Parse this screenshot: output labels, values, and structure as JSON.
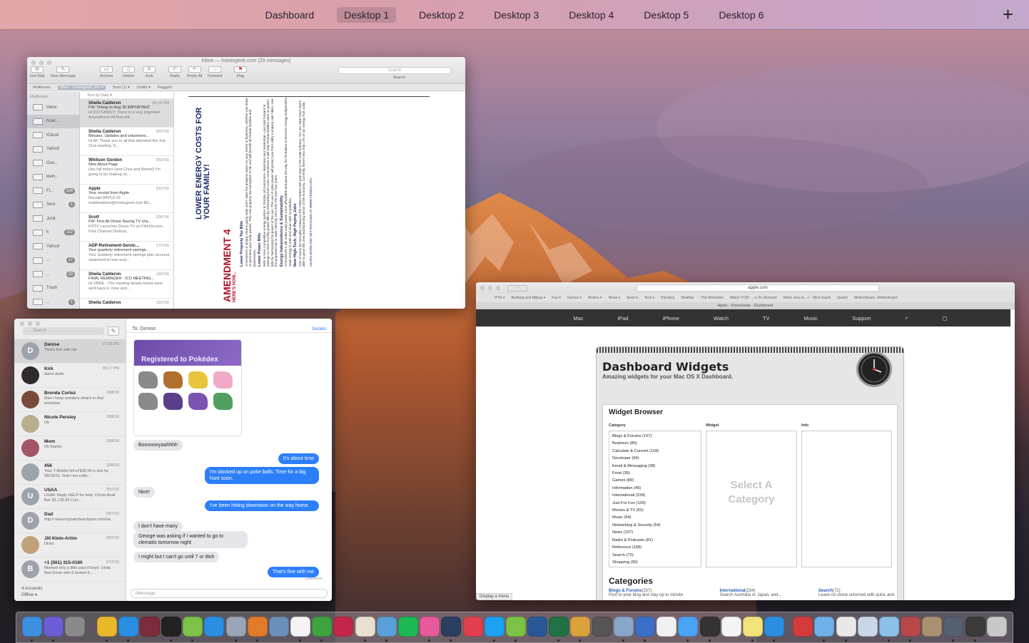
{
  "spaces": {
    "tabs": [
      "Dashboard",
      "Desktop 1",
      "Desktop 2",
      "Desktop 3",
      "Desktop 4",
      "Desktop 5",
      "Desktop 6"
    ],
    "active": "Desktop 1",
    "add_label": "+"
  },
  "mail": {
    "title": "Inbox — howtogeek.com (29 messages)",
    "toolbar": [
      "Get Mail",
      "New Message",
      "Archive",
      "Delete",
      "Junk",
      "Reply",
      "Reply All",
      "Forward",
      "Flag"
    ],
    "search_placeholder": "Search",
    "search_label": "Search",
    "favorites": [
      "Mailboxes",
      "Inbox - howtogeek.com ▾",
      "Sent (1) ▾",
      "Drafts ▾",
      "Flagged"
    ],
    "mailboxes_heading": "Mailboxes",
    "sort_label": "Sort by Date ▾",
    "mailboxes": [
      {
        "name": "Inbox",
        "count": ""
      },
      {
        "name": "howt...",
        "count": ""
      },
      {
        "name": "iCloud",
        "count": ""
      },
      {
        "name": "Yahoo!",
        "count": ""
      },
      {
        "name": "Goo...",
        "count": ""
      },
      {
        "name": "klein...",
        "count": ""
      },
      {
        "name": "Fl...",
        "count": "529"
      },
      {
        "name": "Sent",
        "count": "1"
      },
      {
        "name": "Junk",
        "count": ""
      },
      {
        "name": "h",
        "count": "112"
      },
      {
        "name": "Yahoo!",
        "count": ""
      },
      {
        "name": "...",
        "count": "17"
      },
      {
        "name": "...",
        "count": "20"
      },
      {
        "name": "Trash",
        "count": ""
      },
      {
        "name": "...",
        "count": "1"
      }
    ],
    "messages": [
      {
        "from": "Sheila Calderon",
        "date": "04:10 PM",
        "subject": "FW: Voting on Aug 30 IMPORTANT",
        "preview": "Hi ICO FAMILY: There is a very important Amendment #4 that will..."
      },
      {
        "from": "Sheila Calderon",
        "date": "26/7/16",
        "subject": "Minutes, Updates and volunteers...",
        "preview": "Hi All: Thank you to all that attended the July 21st meeting. It..."
      },
      {
        "from": "Whitson Gordon",
        "date": "26/7/16",
        "subject": "New About Page",
        "preview": "Hey full timers (and Chris and Akemi)! I'm going to be making so..."
      },
      {
        "from": "Apple",
        "date": "21/7/16",
        "subject": "Your receipt from Apple.",
        "preview": "Receipt APPLE ID matthewklein@howtogeek.com Bil..."
      },
      {
        "from": "Scott",
        "date": "20/7/16",
        "subject": "FW: First All Drone Racing TV cha...",
        "preview": "FOTV Launches Drone TV on FilmOn.com, First Channel Dedicat..."
      },
      {
        "from": "ADP-Retirement-Servic...",
        "date": "17/7/16",
        "subject": "Your quarterly retirement savings...",
        "preview": "Your quarterly retirement savings plan account statement is now avai..."
      },
      {
        "from": "Sheila Calderon",
        "date": "13/7/16",
        "subject": "FINAL REMINDER - ICO MEETING...",
        "preview": "Hi YAWE - The meeting details below were sent back in June and..."
      },
      {
        "from": "Sheila Calderon",
        "date": "13/7/16",
        "subject": "",
        "preview": ""
      }
    ],
    "flyer": {
      "amendment": "AMENDMENT 4",
      "tagline": "HERE'S HOW...",
      "headline": "LOWER ENERGY COSTS FOR YOUR FAMILY!",
      "sections": [
        {
          "head": "Lower Property Tax Bills",
          "body": "Amendment 4 simply means going solar won't raise the property taxes on your home or business, whether you lease or purchase your solar panels. This new property tax exemption is fair and will benefit all Florida families and businesses."
        },
        {
          "head": "Lower Power Bills",
          "body": "With a more competitive energy system in Florida, all customers—business and residential—can look forward to savings on their monthly power bills by eliminating fuel costs. Amendment 4 will help Florida families save on power bills by harnessing the power of the sun. The use of solar power will protect you from utility company rate hikes. Use the proposed tax to raise rates by 24% over the next four years."
        },
        {
          "head": "Energy Independence & Sustainability",
          "body": "Amendment 4 will make solar power more affordable and pave the way for Floridians to become energy independent. Solar energy is safe and clean with no pollution."
        },
        {
          "head": "New High-Tech, High Paying Jobs",
          "body": "One of every 83 new jobs created in the United States last year was in the solar industry. Yet, our state hasn't been able to grow this new and booming sector of the economy. Currently there's less than 1% of our energy from solar."
        }
      ],
      "footer": "LEARN MORE AND GET INVOLVED AT WWW.YES0N4.ORG"
    }
  },
  "messages_app": {
    "search_placeholder": "Search",
    "to_label": "To:",
    "to_name": "Denise",
    "details_label": "Details",
    "conversations": [
      {
        "name": "Denise",
        "time": "07:39 PM",
        "snippet": "That's fine with me",
        "initial": "D",
        "color": "#9ea3aa"
      },
      {
        "name": "Kirk",
        "time": "08:17 PM",
        "snippet": "damn dude",
        "initial": "",
        "color": "#2f2b2b"
      },
      {
        "name": "Brenda Cortez",
        "time": "18/8/16",
        "snippet": "Man I keep wonders what's in that envelope",
        "initial": "",
        "color": "#7a4b3a"
      },
      {
        "name": "Nicole Persley",
        "time": "18/8/16",
        "snippet": "Ok",
        "initial": "",
        "color": "#b8ae8e"
      },
      {
        "name": "Mom",
        "time": "18/8/16",
        "snippet": "Ok thanks",
        "initial": "",
        "color": "#a3556a"
      },
      {
        "name": "456",
        "time": "18/8/16",
        "snippet": "Your T-Mobile bill of $96.59 is due by 08/15/16. Visit t-mo.co/bi...",
        "initial": "",
        "color": "#9ea3aa"
      },
      {
        "name": "USAA",
        "time": "30/7/16",
        "snippet": "USAA: Reply HELP for help. Chckn Avail Bal: $1,139.93 Curr...",
        "initial": "U",
        "color": "#9ea3aa"
      },
      {
        "name": "Dad",
        "time": "29/7/16",
        "snippet": "http:// www.mypalmbeachpost.com/ne...",
        "initial": "D",
        "color": "#9ea3aa"
      },
      {
        "name": "Jill Klein-Artim",
        "time": "28/7/16",
        "snippet": "Dicks",
        "initial": "",
        "color": "#c0a27a"
      },
      {
        "name": "+1 (561) 315-0180",
        "time": "27/7/16",
        "snippet": "Worked only a little past 8 boyd. Linda flew Down with 6 broken b...",
        "initial": "B",
        "color": "#9ea3aa"
      }
    ],
    "accounts_label": "4 Accounts",
    "status_label": "Offline ▾",
    "poke_title": "Registered to Pokédex",
    "bubbles": [
      {
        "dir": "in",
        "text": "Booooooyaahhhh"
      },
      {
        "dir": "out",
        "text": "It's about time"
      },
      {
        "dir": "out",
        "text": "I'm stocked up on poke balls. Time for a big hunt soon."
      },
      {
        "dir": "in",
        "text": "Nice!"
      },
      {
        "dir": "out",
        "text": "I've been hitting downtown on the way home."
      },
      {
        "dir": "in",
        "text": "I don't have many"
      },
      {
        "dir": "in",
        "text": "George was asking if I wanted to go to clematis tomorrow night"
      },
      {
        "dir": "in",
        "text": "I might but I can't go until 7 or 8ish"
      },
      {
        "dir": "out",
        "text": "That's fine with me"
      }
    ],
    "delivered_label": "Delivered",
    "input_placeholder": "iMessage"
  },
  "safari": {
    "url": "apple.com",
    "favorites": [
      "HTG ▾",
      "Banking and Billpay ▾",
      "Fun ▾",
      "Games ▾",
      "Movies ▾",
      "News ▾",
      "Sport ▾",
      "Tech ▾",
      "Pandora",
      "Weather",
      "The Weinstein",
      "Watch TCM - ...s On Demand",
      "Metro new sc...> - Slick Depot",
      "Quartz",
      "Motherboard...Motherboard"
    ],
    "tab_title": "Apple - Downloads - Dashboard",
    "nav": [
      "Mac",
      "iPad",
      "iPhone",
      "Watch",
      "TV",
      "Music",
      "Support"
    ],
    "page_title": "Dashboard Widgets",
    "page_subtitle": "Amazing widgets for your Mac OS X Dashboard.",
    "browser_title": "Widget Browser",
    "col_category": "Category",
    "col_widget": "Widget",
    "col_info": "Info",
    "categories": [
      "Blogs & Forums (157)",
      "Business (85)",
      "Calculate & Convert (118)",
      "Developer (64)",
      "Email & Messaging (38)",
      "Food (35)",
      "Games (89)",
      "Information (49)",
      "International (234)",
      "Just For Fun (109)",
      "Movies & TV (62)",
      "Music (64)",
      "Networking & Security (54)",
      "News (107)",
      "Radio & Podcasts (81)",
      "Reference (168)",
      "Search (72)",
      "Shopping (90)"
    ],
    "select_prompt": "Select A Category",
    "categories_heading": "Categories",
    "category_links": [
      {
        "name": "Blogs & Forums",
        "count": "(157)",
        "desc": "Post to your blog and stay up to minute"
      },
      {
        "name": "International",
        "count": "(234)",
        "desc": "Search Australia or Japan, and..."
      },
      {
        "name": "Search",
        "count": "(72)",
        "desc": "Leave no stone unturned with quick and"
      }
    ],
    "status_text": "Display a menu"
  },
  "dock": {
    "apps": [
      {
        "name": "finder",
        "color": "#3d8fe0"
      },
      {
        "name": "siri",
        "color": "#6b5dd3"
      },
      {
        "name": "system-preferences",
        "color": "#8a8a8a"
      },
      {
        "name": "chrome",
        "color": "#e9b82a"
      },
      {
        "name": "safari",
        "color": "#2a8fe3"
      },
      {
        "name": "scrivener",
        "color": "#7a2b3c"
      },
      {
        "name": "terminal",
        "color": "#222222"
      },
      {
        "name": "android-file",
        "color": "#7cc246"
      },
      {
        "name": "app-store",
        "color": "#2a8fe3"
      },
      {
        "name": "launchpad",
        "color": "#9ba4b4"
      },
      {
        "name": "ibooks",
        "color": "#e07b2a"
      },
      {
        "name": "preview",
        "color": "#6a8fb8"
      },
      {
        "name": "calendar",
        "color": "#f4f4f4"
      },
      {
        "name": "podcasts-app",
        "color": "#3fa33f"
      },
      {
        "name": "lastpass",
        "color": "#c2274b"
      },
      {
        "name": "photos",
        "color": "#e8e0d0"
      },
      {
        "name": "fish-app",
        "color": "#5aa0d8"
      },
      {
        "name": "spotify",
        "color": "#1db954"
      },
      {
        "name": "itunes",
        "color": "#e85a9b"
      },
      {
        "name": "steam",
        "color": "#2a3f5f"
      },
      {
        "name": "pocket",
        "color": "#e0404d"
      },
      {
        "name": "twitter",
        "color": "#1da1f2"
      },
      {
        "name": "android",
        "color": "#7cc246"
      },
      {
        "name": "word",
        "color": "#2b5797"
      },
      {
        "name": "excel",
        "color": "#207245"
      },
      {
        "name": "colorsync",
        "color": "#d9a23b"
      },
      {
        "name": "calculator",
        "color": "#555555"
      },
      {
        "name": "image-capture",
        "color": "#8aa6c8"
      },
      {
        "name": "onepassword",
        "color": "#3b6fc9"
      },
      {
        "name": "notes-list",
        "color": "#f0f0f0"
      },
      {
        "name": "messages",
        "color": "#4aa3f5"
      },
      {
        "name": "alfred",
        "color": "#333333"
      },
      {
        "name": "ia-writer",
        "color": "#f4f4f4"
      },
      {
        "name": "stickies",
        "color": "#f3e27a"
      },
      {
        "name": "windows",
        "color": "#2a8fe3"
      },
      {
        "name": "parallels",
        "color": "#d43c3c"
      },
      {
        "name": "folder-apps",
        "color": "#6fb1e8"
      },
      {
        "name": "document",
        "color": "#e8e8e8"
      },
      {
        "name": "folder-mail",
        "color": "#c8d8e8"
      },
      {
        "name": "folder-downloads",
        "color": "#8cc0e8"
      },
      {
        "name": "magazine",
        "color": "#b84848"
      },
      {
        "name": "photo-stack",
        "color": "#a89070"
      },
      {
        "name": "screenshot-folder",
        "color": "#556070"
      },
      {
        "name": "display",
        "color": "#3a3a3a"
      },
      {
        "name": "trash",
        "color": "#c8c8c8"
      }
    ]
  }
}
